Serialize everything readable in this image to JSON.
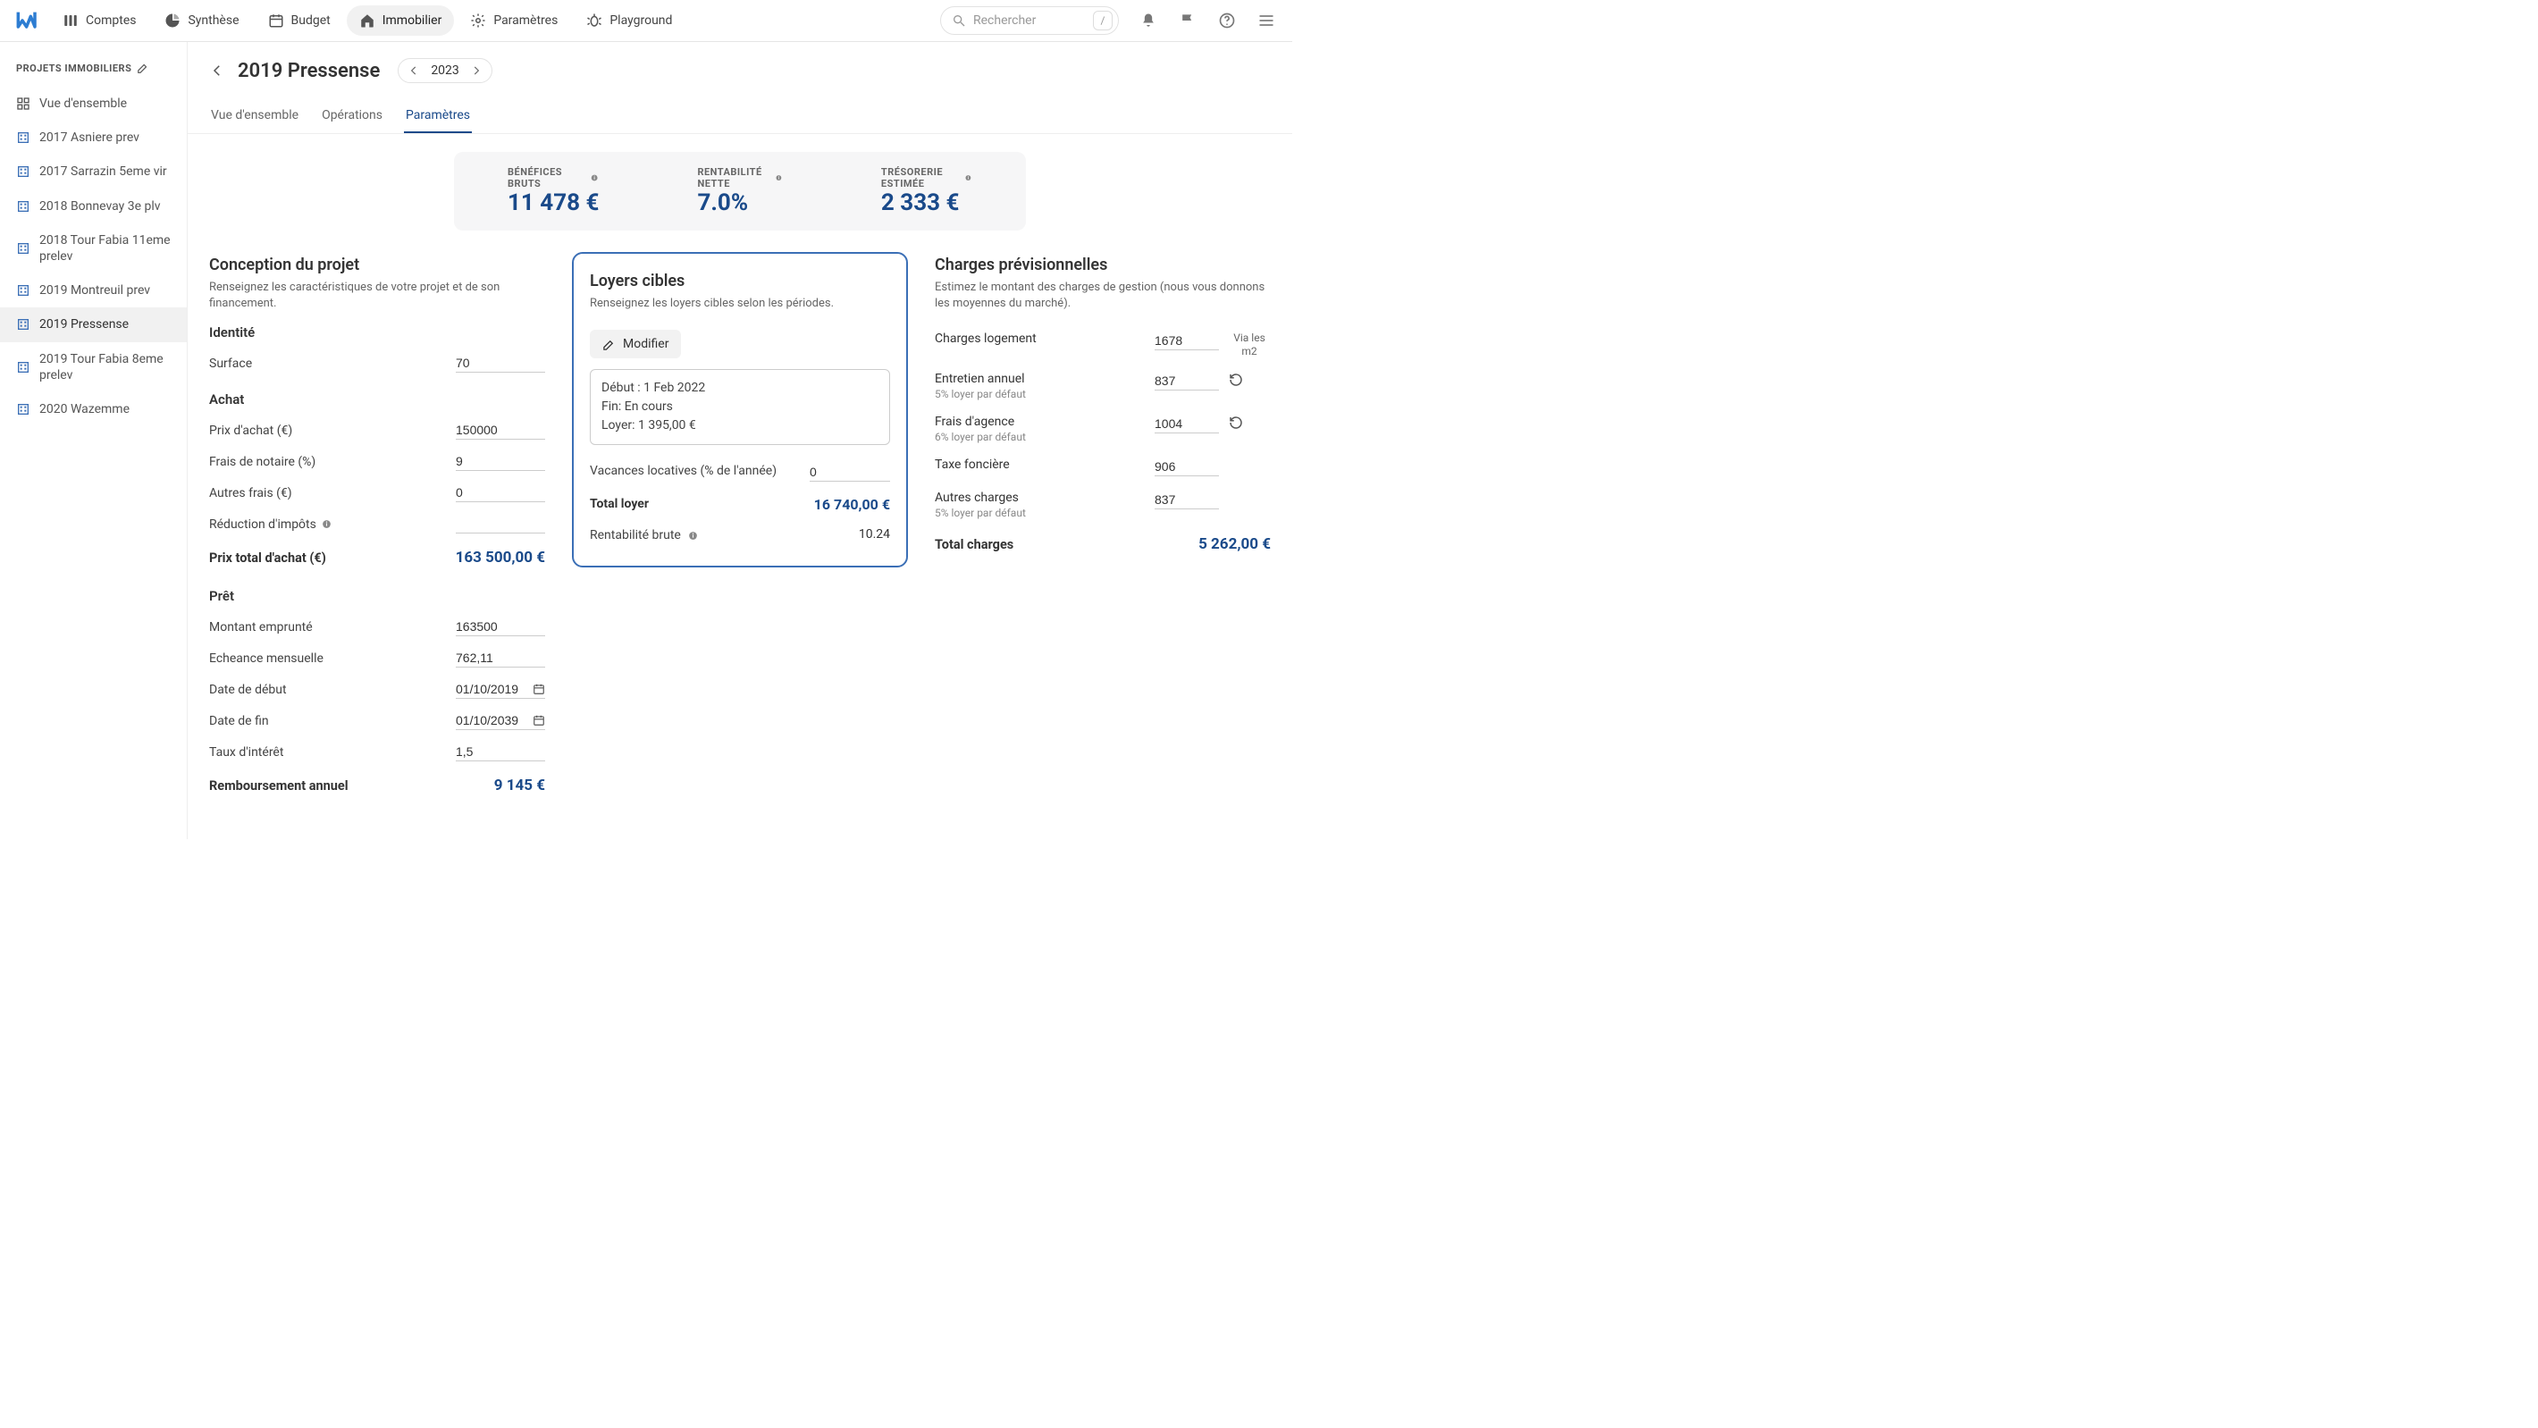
{
  "nav": {
    "items": [
      {
        "label": "Comptes",
        "icon": "columns"
      },
      {
        "label": "Synthèse",
        "icon": "pie"
      },
      {
        "label": "Budget",
        "icon": "calendar"
      },
      {
        "label": "Immobilier",
        "icon": "home",
        "active": true
      },
      {
        "label": "Paramètres",
        "icon": "gear"
      },
      {
        "label": "Playground",
        "icon": "bug"
      }
    ],
    "search_placeholder": "Rechercher",
    "search_key": "/"
  },
  "sidebar": {
    "title": "PROJETS IMMOBILIERS",
    "overview": "Vue d'ensemble",
    "items": [
      "2017 Asniere prev",
      "2017 Sarrazin 5eme vir",
      "2018 Bonnevay 3e plv",
      "2018 Tour Fabia 11eme prelev",
      "2019 Montreuil prev",
      "2019 Pressense",
      "2019 Tour Fabia 8eme prelev",
      "2020 Wazemme"
    ],
    "active_index": 5
  },
  "header": {
    "title": "2019 Pressense",
    "year": "2023",
    "tabs": [
      "Vue d'ensemble",
      "Opérations",
      "Paramètres"
    ],
    "active_tab": 2
  },
  "kpis": [
    {
      "label": "BÉNÉFICES BRUTS",
      "value": "11 478 €"
    },
    {
      "label": "RENTABILITÉ NETTE",
      "value": "7.0%"
    },
    {
      "label": "TRÉSORERIE ESTIMÉE",
      "value": "2 333 €"
    }
  ],
  "conception": {
    "title": "Conception du projet",
    "subtitle": "Renseignez les caractéristiques de votre projet et de son financement.",
    "identite": {
      "heading": "Identité",
      "surface_label": "Surface",
      "surface": "70"
    },
    "achat": {
      "heading": "Achat",
      "prix_label": "Prix d'achat (€)",
      "prix": "150000",
      "notaire_label": "Frais de notaire (%)",
      "notaire": "9",
      "autres_label": "Autres frais (€)",
      "autres": "0",
      "reduction_label": "Réduction d'impôts",
      "reduction": "",
      "total_label": "Prix total d'achat (€)",
      "total": "163 500,00 €"
    },
    "pret": {
      "heading": "Prêt",
      "montant_label": "Montant emprunté",
      "montant": "163500",
      "echeance_label": "Echeance mensuelle",
      "echeance": "762,11",
      "debut_label": "Date de début",
      "debut": "01/10/2019",
      "fin_label": "Date de fin",
      "fin": "01/10/2039",
      "taux_label": "Taux d'intérêt",
      "taux": "1,5",
      "remb_label": "Remboursement annuel",
      "remb": "9 145 €"
    }
  },
  "loyers": {
    "title": "Loyers cibles",
    "subtitle": "Renseignez les loyers cibles selon les périodes.",
    "modify": "Modifier",
    "period": {
      "l1": "Début : 1 Feb 2022",
      "l2": "Fin: En cours",
      "l3": "Loyer: 1 395,00 €"
    },
    "vacances_label": "Vacances locatives (% de l'année)",
    "vacances": "0",
    "total_label": "Total loyer",
    "total": "16 740,00 €",
    "rent_label": "Rentabilité brute",
    "rent": "10.24"
  },
  "charges": {
    "title": "Charges prévisionnelles",
    "subtitle": "Estimez le montant des charges de gestion (nous vous donnons les moyennes du marché).",
    "rows": [
      {
        "label": "Charges logement",
        "sub": "",
        "value": "1678",
        "extra": "Via les m2"
      },
      {
        "label": "Entretien annuel",
        "sub": "5% loyer par défaut",
        "value": "837",
        "extra": "reset"
      },
      {
        "label": "Frais d'agence",
        "sub": "6% loyer par défaut",
        "value": "1004",
        "extra": "reset"
      },
      {
        "label": "Taxe foncière",
        "sub": "",
        "value": "906",
        "extra": ""
      },
      {
        "label": "Autres charges",
        "sub": "5% loyer par défaut",
        "value": "837",
        "extra": ""
      }
    ],
    "total_label": "Total charges",
    "total": "5 262,00 €"
  }
}
